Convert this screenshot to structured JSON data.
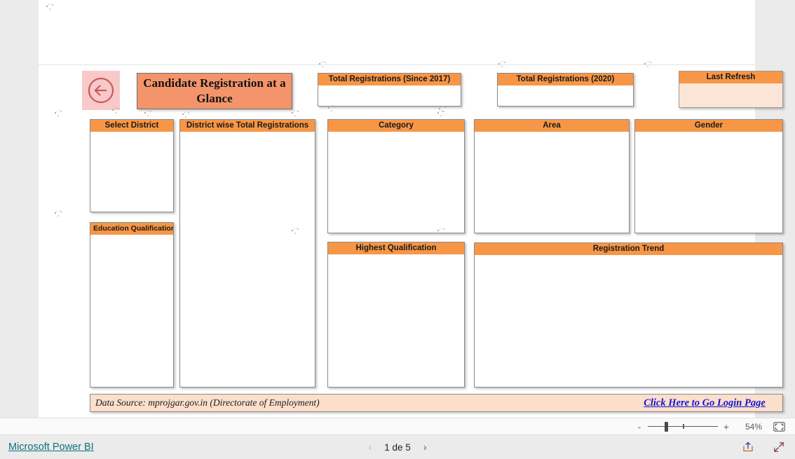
{
  "report": {
    "back_button": {
      "icon": "circle-arrow-left-icon"
    },
    "title": "Candidate Registration at a Glance",
    "kpi_cards": [
      {
        "name": "total-registrations-since-2017",
        "header": "Total Registrations (Since 2017)",
        "value": ""
      },
      {
        "name": "total-registrations-2020",
        "header": "Total Registrations (2020)",
        "value": ""
      },
      {
        "name": "last-refresh",
        "header": "Last Refresh",
        "value": ""
      }
    ],
    "panels": [
      {
        "name": "select-district",
        "header": "Select District"
      },
      {
        "name": "district-wise-total-registrations",
        "header": "District wise Total Registrations"
      },
      {
        "name": "category",
        "header": "Category"
      },
      {
        "name": "area",
        "header": "Area"
      },
      {
        "name": "gender",
        "header": "Gender"
      },
      {
        "name": "education-qualification",
        "header": "Education Qualification"
      },
      {
        "name": "highest-qualification",
        "header": "Highest Qualification"
      },
      {
        "name": "registration-trend",
        "header": "Registration Trend"
      }
    ],
    "footer": {
      "data_source": "Data Source: mprojgar.gov.in (Directorate of Employment)",
      "login_link": "Click Here to Go Login Page"
    }
  },
  "zoom_bar": {
    "minus_label": "-",
    "plus_label": "+",
    "zoom_value": "54%",
    "fit_icon": "fit-to-page-icon"
  },
  "status_bar": {
    "brand": "Microsoft Power BI",
    "page_indicator": "1 de 5",
    "prev_icon": "chevron-left-icon",
    "next_icon": "chevron-right-icon",
    "share_icon": "share-icon",
    "fullscreen_icon": "fullscreen-icon"
  },
  "colors": {
    "header_orange": "#F79646",
    "title_salmon": "#F4946A",
    "back_pink": "#F9C8C8",
    "footer_peach": "#FBDFCB",
    "link_blue": "#1414d6",
    "brand_teal": "#13707c"
  }
}
